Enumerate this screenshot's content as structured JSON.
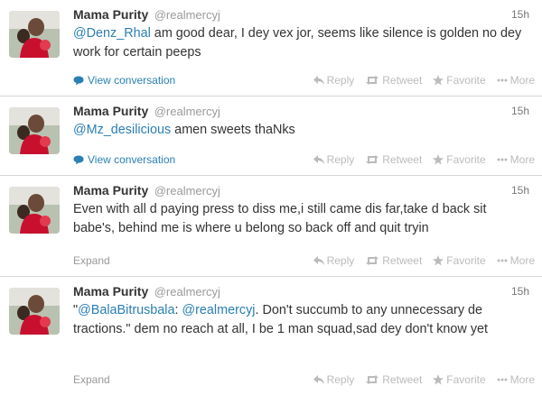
{
  "tweets": [
    {
      "fullname": "Mama Purity",
      "username": "@realmercyj",
      "time": "15h",
      "mention": "@Denz_Rhal",
      "text": " am good dear, I dey vex jor, seems like silence is golden no dey work for certain peeps",
      "link": "View conversation",
      "actions": {
        "reply": "Reply",
        "retweet": "Retweet",
        "favorite": "Favorite",
        "more": "More"
      }
    },
    {
      "fullname": "Mama Purity",
      "username": "@realmercyj",
      "time": "15h",
      "mention": "@Mz_desilicious",
      "text": " amen sweets thaNks",
      "link": "View conversation",
      "actions": {
        "reply": "Reply",
        "retweet": "Retweet",
        "favorite": "Favorite",
        "more": "More"
      }
    },
    {
      "fullname": "Mama Purity",
      "username": "@realmercyj",
      "time": "15h",
      "text": "Even with all d paying press to diss me,i still came dis far,take d back sit babe's, behind me is where u belong so back off and quit tryin",
      "link": "Expand",
      "actions": {
        "reply": "Reply",
        "retweet": "Retweet",
        "favorite": "Favorite",
        "more": "More"
      }
    },
    {
      "fullname": "Mama Purity",
      "username": "@realmercyj",
      "time": "15h",
      "quote_open": "\"",
      "mention": "@BalaBitrusbala",
      "sep": ": ",
      "mention2": "@realmercyj",
      "text": ". Don't succumb to any unnecessary de tractions.\" dem no reach at all, I be 1 man squad,sad dey don't know yet",
      "link": "Expand",
      "actions": {
        "reply": "Reply",
        "retweet": "Retweet",
        "favorite": "Favorite",
        "more": "More"
      }
    }
  ],
  "colors": {
    "link": "#2a7fb3",
    "muted": "#999999",
    "action": "#bbbbbb"
  },
  "icons": [
    "speech-bubble-icon",
    "reply-icon",
    "retweet-icon",
    "star-icon",
    "more-dots-icon"
  ]
}
